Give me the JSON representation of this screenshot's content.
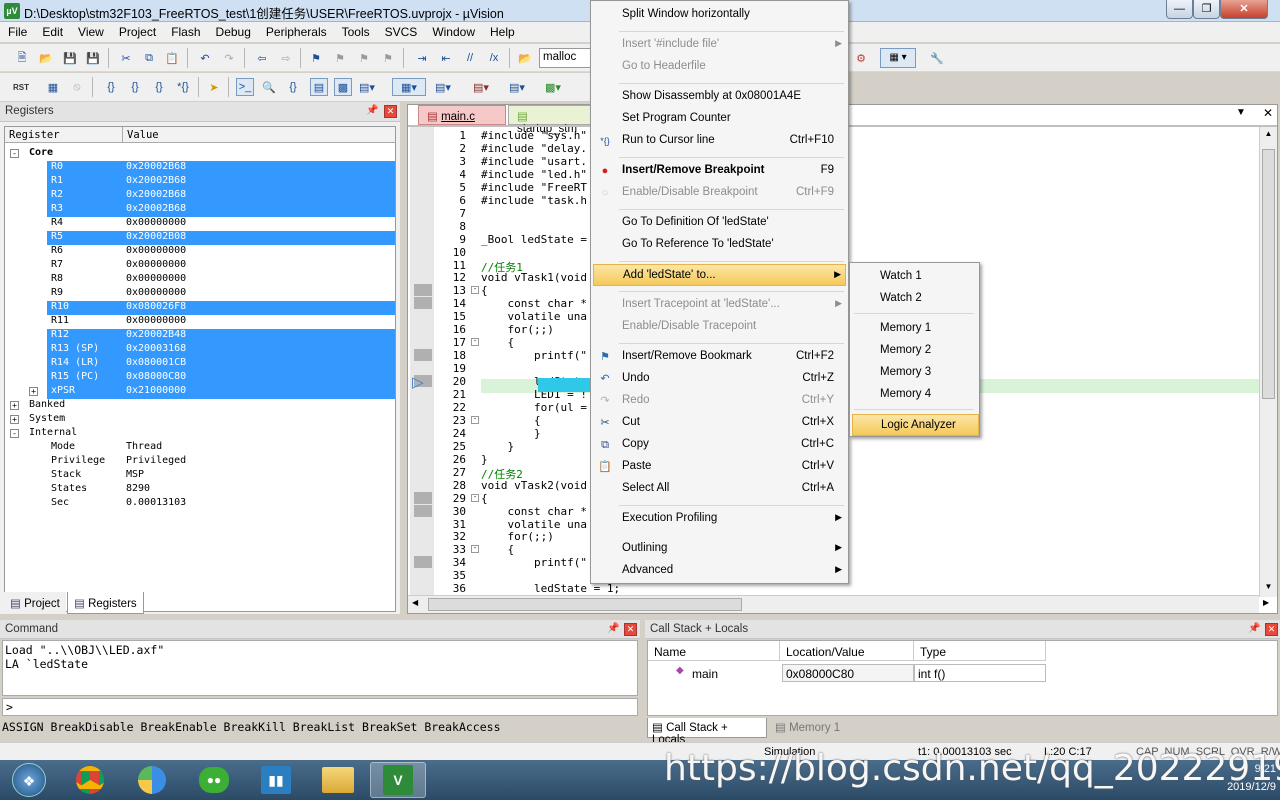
{
  "window": {
    "title": "D:\\Desktop\\stm32F103_FreeRTOS_test\\1创建任务\\USER\\FreeRTOS.uvprojx - µVision",
    "app_icon": "µV"
  },
  "menubar": [
    "File",
    "Edit",
    "View",
    "Project",
    "Flash",
    "Debug",
    "Peripherals",
    "Tools",
    "SVCS",
    "Window",
    "Help"
  ],
  "toolbar": {
    "search_value": "malloc",
    "rst_label": "RST"
  },
  "registers": {
    "title": "Registers",
    "col_register": "Register",
    "col_value": "Value",
    "core_label": "Core",
    "core": [
      {
        "name": "R0",
        "value": "0x20002B68",
        "selected": true
      },
      {
        "name": "R1",
        "value": "0x20002B68",
        "selected": true
      },
      {
        "name": "R2",
        "value": "0x20002B68",
        "selected": true
      },
      {
        "name": "R3",
        "value": "0x20002B68",
        "selected": true
      },
      {
        "name": "R4",
        "value": "0x00000000",
        "selected": false
      },
      {
        "name": "R5",
        "value": "0x20002B08",
        "selected": true
      },
      {
        "name": "R6",
        "value": "0x00000000",
        "selected": false
      },
      {
        "name": "R7",
        "value": "0x00000000",
        "selected": false
      },
      {
        "name": "R8",
        "value": "0x00000000",
        "selected": false
      },
      {
        "name": "R9",
        "value": "0x00000000",
        "selected": false
      },
      {
        "name": "R10",
        "value": "0x080026F8",
        "selected": true
      },
      {
        "name": "R11",
        "value": "0x00000000",
        "selected": false
      },
      {
        "name": "R12",
        "value": "0x20002B48",
        "selected": true
      },
      {
        "name": "R13 (SP)",
        "value": "0x20003168",
        "selected": true
      },
      {
        "name": "R14 (LR)",
        "value": "0x080001CB",
        "selected": true
      },
      {
        "name": "R15 (PC)",
        "value": "0x08000C80",
        "selected": true
      },
      {
        "name": "xPSR",
        "value": "0x21000000",
        "selected": true
      }
    ],
    "groups": [
      "Banked",
      "System",
      "Internal"
    ],
    "internal": [
      {
        "name": "Mode",
        "value": "Thread"
      },
      {
        "name": "Privilege",
        "value": "Privileged"
      },
      {
        "name": "Stack",
        "value": "MSP"
      },
      {
        "name": "States",
        "value": "8290"
      },
      {
        "name": "Sec",
        "value": "0.00013103"
      }
    ],
    "tab_project": "Project",
    "tab_registers": "Registers"
  },
  "editor": {
    "tab_main": "main.c",
    "tab_startup": "startup_stm",
    "lines": [
      {
        "n": "1",
        "t": "#include \"sys.h\""
      },
      {
        "n": "2",
        "t": "#include \"delay."
      },
      {
        "n": "3",
        "t": "#include \"usart."
      },
      {
        "n": "4",
        "t": "#include \"led.h\""
      },
      {
        "n": "5",
        "t": "#include \"FreeRT"
      },
      {
        "n": "6",
        "t": "#include \"task.h"
      },
      {
        "n": "7",
        "t": ""
      },
      {
        "n": "8",
        "t": ""
      },
      {
        "n": "9",
        "t": "_Bool ledState ="
      },
      {
        "n": "10",
        "t": ""
      },
      {
        "n": "11",
        "t": "//任务1"
      },
      {
        "n": "12",
        "t": "void vTask1(void"
      },
      {
        "n": "13",
        "t": "{"
      },
      {
        "n": "14",
        "t": "    const char *"
      },
      {
        "n": "15",
        "t": "    volatile una"
      },
      {
        "n": "16",
        "t": "    for(;;)"
      },
      {
        "n": "17",
        "t": "    {"
      },
      {
        "n": "18",
        "t": "        printf(\""
      },
      {
        "n": "19",
        "t": ""
      },
      {
        "n": "20",
        "t": "        ledState"
      },
      {
        "n": "21",
        "t": "        LED1 = !"
      },
      {
        "n": "22",
        "t": "        for(ul ="
      },
      {
        "n": "23",
        "t": "        {"
      },
      {
        "n": "24",
        "t": "        }"
      },
      {
        "n": "25",
        "t": "    }"
      },
      {
        "n": "26",
        "t": "}"
      },
      {
        "n": "27",
        "t": "//任务2"
      },
      {
        "n": "28",
        "t": "void vTask2(void"
      },
      {
        "n": "29",
        "t": "{"
      },
      {
        "n": "30",
        "t": "    const char *"
      },
      {
        "n": "31",
        "t": "    volatile una"
      },
      {
        "n": "32",
        "t": "    for(;;)"
      },
      {
        "n": "33",
        "t": "    {"
      },
      {
        "n": "34",
        "t": "        printf(\""
      },
      {
        "n": "35",
        "t": ""
      },
      {
        "n": "36",
        "t": "        ledState = 1;"
      }
    ]
  },
  "context_menu": {
    "items": [
      {
        "label": "Split Window horizontally",
        "shortcut": "",
        "disabled": false,
        "arrow": false,
        "icon": ""
      },
      {
        "label": "Insert '#include file'",
        "shortcut": "",
        "disabled": true,
        "arrow": true,
        "icon": ""
      },
      {
        "label": "Go to Headerfile",
        "shortcut": "",
        "disabled": true,
        "arrow": false,
        "icon": ""
      },
      {
        "label": "Show Disassembly at 0x08001A4E",
        "shortcut": "",
        "disabled": false,
        "arrow": false,
        "icon": ""
      },
      {
        "label": "Set Program Counter",
        "shortcut": "",
        "disabled": false,
        "arrow": false,
        "icon": ""
      },
      {
        "label": "Run to Cursor line",
        "shortcut": "Ctrl+F10",
        "disabled": false,
        "arrow": false,
        "icon": "run-to-cursor"
      },
      {
        "label": "Insert/Remove Breakpoint",
        "shortcut": "F9",
        "disabled": false,
        "arrow": false,
        "icon": "breakpoint",
        "bold": true
      },
      {
        "label": "Enable/Disable Breakpoint",
        "shortcut": "Ctrl+F9",
        "disabled": true,
        "arrow": false,
        "icon": "breakpoint-off"
      },
      {
        "label": "Go To Definition Of 'ledState'",
        "shortcut": "",
        "disabled": false,
        "arrow": false,
        "icon": ""
      },
      {
        "label": "Go To Reference To 'ledState'",
        "shortcut": "",
        "disabled": false,
        "arrow": false,
        "icon": ""
      },
      {
        "label": "Add 'ledState' to...",
        "shortcut": "",
        "disabled": false,
        "arrow": true,
        "icon": "",
        "highlight": true
      },
      {
        "label": "Insert Tracepoint at 'ledState'...",
        "shortcut": "",
        "disabled": true,
        "arrow": true,
        "icon": ""
      },
      {
        "label": "Enable/Disable Tracepoint",
        "shortcut": "",
        "disabled": true,
        "arrow": false,
        "icon": ""
      },
      {
        "label": "Insert/Remove Bookmark",
        "shortcut": "Ctrl+F2",
        "disabled": false,
        "arrow": false,
        "icon": "bookmark"
      },
      {
        "label": "Undo",
        "shortcut": "Ctrl+Z",
        "disabled": false,
        "arrow": false,
        "icon": "undo"
      },
      {
        "label": "Redo",
        "shortcut": "Ctrl+Y",
        "disabled": true,
        "arrow": false,
        "icon": "redo"
      },
      {
        "label": "Cut",
        "shortcut": "Ctrl+X",
        "disabled": false,
        "arrow": false,
        "icon": "cut"
      },
      {
        "label": "Copy",
        "shortcut": "Ctrl+C",
        "disabled": false,
        "arrow": false,
        "icon": "copy"
      },
      {
        "label": "Paste",
        "shortcut": "Ctrl+V",
        "disabled": false,
        "arrow": false,
        "icon": "paste"
      },
      {
        "label": "Select All",
        "shortcut": "Ctrl+A",
        "disabled": false,
        "arrow": false,
        "icon": ""
      },
      {
        "label": "Execution Profiling",
        "shortcut": "",
        "disabled": false,
        "arrow": true,
        "icon": ""
      },
      {
        "label": "Outlining",
        "shortcut": "",
        "disabled": false,
        "arrow": true,
        "icon": ""
      },
      {
        "label": "Advanced",
        "shortcut": "",
        "disabled": false,
        "arrow": true,
        "icon": ""
      }
    ]
  },
  "submenu": {
    "items": [
      "Watch 1",
      "Watch 2",
      "Memory 1",
      "Memory 2",
      "Memory 3",
      "Memory 4",
      "Logic Analyzer"
    ],
    "highlighted": "Logic Analyzer"
  },
  "command": {
    "title": "Command",
    "output": [
      "Load \"..\\\\OBJ\\\\LED.axf\"",
      "LA `ledState"
    ],
    "prompt": ">",
    "hint": "ASSIGN BreakDisable BreakEnable BreakKill BreakList BreakSet BreakAccess"
  },
  "callstack": {
    "title": "Call Stack + Locals",
    "col_name": "Name",
    "col_location": "Location/Value",
    "col_type": "Type",
    "row": {
      "name": "main",
      "location": "0x08000C80",
      "type": "int f()"
    },
    "tab_callstack": "Call Stack + Locals",
    "tab_memory": "Memory 1"
  },
  "statusbar": {
    "mode": "Simulation",
    "time": "t1: 0.00013103 sec",
    "position": "L:20 C:17",
    "indicators": "CAP  NUM  SCRL  OVR  R/W"
  },
  "taskbar": {
    "clock_time": "9:21",
    "clock_date": "2019/12/9"
  },
  "watermark": "https://blog.csdn.net/qq_20222919"
}
